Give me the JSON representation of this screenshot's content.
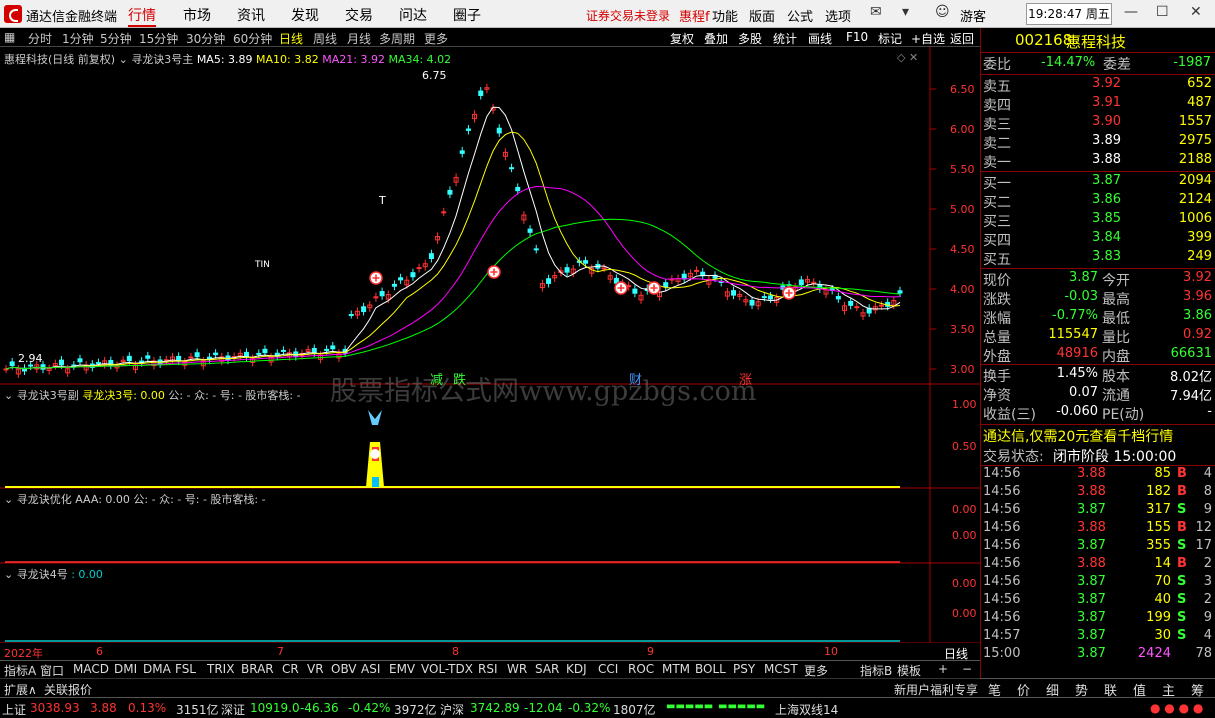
{
  "titlebar": {
    "app_name": "通达信金融终端",
    "menus": [
      "行情",
      "市场",
      "资讯",
      "发现",
      "交易",
      "问达",
      "圈子"
    ],
    "notice": "证券交易未登录",
    "stock_short": "惠程f",
    "menus2": [
      "功能",
      "版面",
      "公式",
      "选项"
    ],
    "user": "游客",
    "clock": "19:28:47 周五"
  },
  "toolbar": {
    "periods": [
      "分时",
      "1分钟",
      "5分钟",
      "15分钟",
      "30分钟",
      "60分钟",
      "日线",
      "周线",
      "月线",
      "多周期",
      "更多"
    ],
    "selected": "日线",
    "right_buttons": [
      "复权",
      "叠加",
      "多股",
      "统计",
      "画线",
      "F10",
      "标记",
      "+自选",
      "返回"
    ]
  },
  "main_chart": {
    "stock": "惠程科技(日线 前复权)",
    "indicator": "寻龙诀3号主",
    "ma5_label": "MA5: 3.89",
    "ma10_label": "MA10: 3.82",
    "ma21_label": "MA21: 3.92",
    "ma34_label": "MA34: 4.02",
    "high_label": "6.75",
    "low_label": "2.94",
    "price_ticks": [
      "6.50",
      "6.00",
      "5.50",
      "5.00",
      "4.50",
      "4.00",
      "3.50",
      "3.00"
    ],
    "markers": [
      "减",
      "跌",
      "财",
      "涨"
    ],
    "watermark": "股票指标公式网www.gpzbgs.com",
    "tr_label": "T",
    "tin_label": "TIN"
  },
  "sub1": {
    "title": "寻龙诀3号副",
    "val_name": "寻龙决3号: 0.00",
    "rest": "公: -  众: -  号: -  股市客栈: -",
    "ticks": [
      "1.00",
      "0.50"
    ]
  },
  "sub2": {
    "title": "寻龙诀优化",
    "rest": "AAA: 0.00  公: -  众: -  号: -  股市客栈: -",
    "ticks": [
      "0.00",
      "0.00"
    ]
  },
  "sub3": {
    "title": "寻龙诀4号",
    "rest": ": 0.00",
    "ticks": [
      "0.00",
      "0.00"
    ]
  },
  "xaxis": {
    "labels": [
      "2022年",
      "6",
      "7",
      "8",
      "9",
      "10"
    ],
    "period": "日线"
  },
  "bottom_tabs": [
    "指标A",
    "窗口",
    "MACD",
    "DMI",
    "DMA",
    "FSL",
    "TRIX",
    "BRAR",
    "CR",
    "VR",
    "OBV",
    "ASI",
    "EMV",
    "VOL-TDX",
    "RSI",
    "WR",
    "SAR",
    "KDJ",
    "CCI",
    "ROC",
    "MTM",
    "BOLL",
    "PSY",
    "MCST",
    "更多",
    "指标B",
    "模板",
    "+",
    "−"
  ],
  "row2": {
    "expand": "扩展∧",
    "related": "关联报价",
    "promo": "新用户福利专享"
  },
  "quote": {
    "code": "002168",
    "name": "惠程科技",
    "weibi_label": "委比",
    "weibi": "-14.47%",
    "weicha_label": "委差",
    "weicha": "-1987",
    "asks": [
      {
        "l": "卖五",
        "p": "3.92",
        "v": "652"
      },
      {
        "l": "卖四",
        "p": "3.91",
        "v": "487"
      },
      {
        "l": "卖三",
        "p": "3.90",
        "v": "1557"
      },
      {
        "l": "卖二",
        "p": "3.89",
        "v": "2975"
      },
      {
        "l": "卖一",
        "p": "3.88",
        "v": "2188"
      }
    ],
    "bids": [
      {
        "l": "买一",
        "p": "3.87",
        "v": "2094"
      },
      {
        "l": "买二",
        "p": "3.86",
        "v": "2124"
      },
      {
        "l": "买三",
        "p": "3.85",
        "v": "1006"
      },
      {
        "l": "买四",
        "p": "3.84",
        "v": "399"
      },
      {
        "l": "买五",
        "p": "3.83",
        "v": "249"
      }
    ],
    "stats": [
      {
        "l1": "现价",
        "v1": "3.87",
        "l2": "今开",
        "v2": "3.92"
      },
      {
        "l1": "涨跌",
        "v1": "-0.03",
        "l2": "最高",
        "v2": "3.96"
      },
      {
        "l1": "涨幅",
        "v1": "-0.77%",
        "l2": "最低",
        "v2": "3.86"
      },
      {
        "l1": "总量",
        "v1": "115547",
        "l2": "量比",
        "v2": "0.92"
      },
      {
        "l1": "外盘",
        "v1": "48916",
        "l2": "内盘",
        "v2": "66631"
      }
    ],
    "stats2": [
      {
        "l1": "换手",
        "v1": "1.45%",
        "l2": "股本",
        "v2": "8.02亿"
      },
      {
        "l1": "净资",
        "v1": "0.07",
        "l2": "流通",
        "v2": "7.94亿"
      },
      {
        "l1": "收益(三)",
        "v1": "-0.060",
        "l2": "PE(动)",
        "v2": "-"
      }
    ],
    "promo": "通达信,仅需20元查看千档行情",
    "status_label": "交易状态:",
    "status": "闭市阶段 15:00:00",
    "ticks": [
      {
        "t": "14:56",
        "p": "3.88",
        "v": "85",
        "s": "B",
        "n": "4"
      },
      {
        "t": "14:56",
        "p": "3.88",
        "v": "182",
        "s": "B",
        "n": "8"
      },
      {
        "t": "14:56",
        "p": "3.87",
        "v": "317",
        "s": "S",
        "n": "9"
      },
      {
        "t": "14:56",
        "p": "3.88",
        "v": "155",
        "s": "B",
        "n": "12"
      },
      {
        "t": "14:56",
        "p": "3.87",
        "v": "355",
        "s": "S",
        "n": "17"
      },
      {
        "t": "14:56",
        "p": "3.88",
        "v": "14",
        "s": "B",
        "n": "2"
      },
      {
        "t": "14:56",
        "p": "3.87",
        "v": "70",
        "s": "S",
        "n": "3"
      },
      {
        "t": "14:56",
        "p": "3.87",
        "v": "40",
        "s": "S",
        "n": "2"
      },
      {
        "t": "14:56",
        "p": "3.87",
        "v": "199",
        "s": "S",
        "n": "9"
      },
      {
        "t": "14:57",
        "p": "3.87",
        "v": "30",
        "s": "S",
        "n": "4"
      },
      {
        "t": "15:00",
        "p": "3.87",
        "v": "2424",
        "s": "",
        "n": "78"
      }
    ],
    "tabs": [
      "笔",
      "价",
      "细",
      "势",
      "联",
      "值",
      "主",
      "筹"
    ]
  },
  "statusbar": {
    "sh_label": "上证",
    "sh_val": "3038.93",
    "sh_chg": "3.88",
    "sh_pct": "0.13%",
    "sh_amt": "3151亿",
    "sz_label": "深证",
    "sz_val": "10919.0",
    "sz_chg": "-46.36",
    "sz_pct": "-0.42%",
    "sz_amt": "3972亿",
    "hs_label": "沪深",
    "hs_val": "3742.89",
    "hs_chg": "-12.04",
    "hs_pct": "-0.32%",
    "hs_amt": "1807亿",
    "ticker": "上海双线14"
  },
  "colors": {
    "up": "#ff3333",
    "down": "#33ffff",
    "ma5": "#ffffff",
    "ma10": "#ffff00",
    "ma21": "#ff00ff",
    "ma34": "#00ff00"
  },
  "chart_data": {
    "type": "candlestick",
    "price_ticks": [
      6.5,
      6.0,
      5.5,
      5.0,
      4.5,
      4.0,
      3.5,
      3.0
    ],
    "ylim": [
      2.9,
      6.9
    ],
    "high": 6.75,
    "low": 2.94
  }
}
